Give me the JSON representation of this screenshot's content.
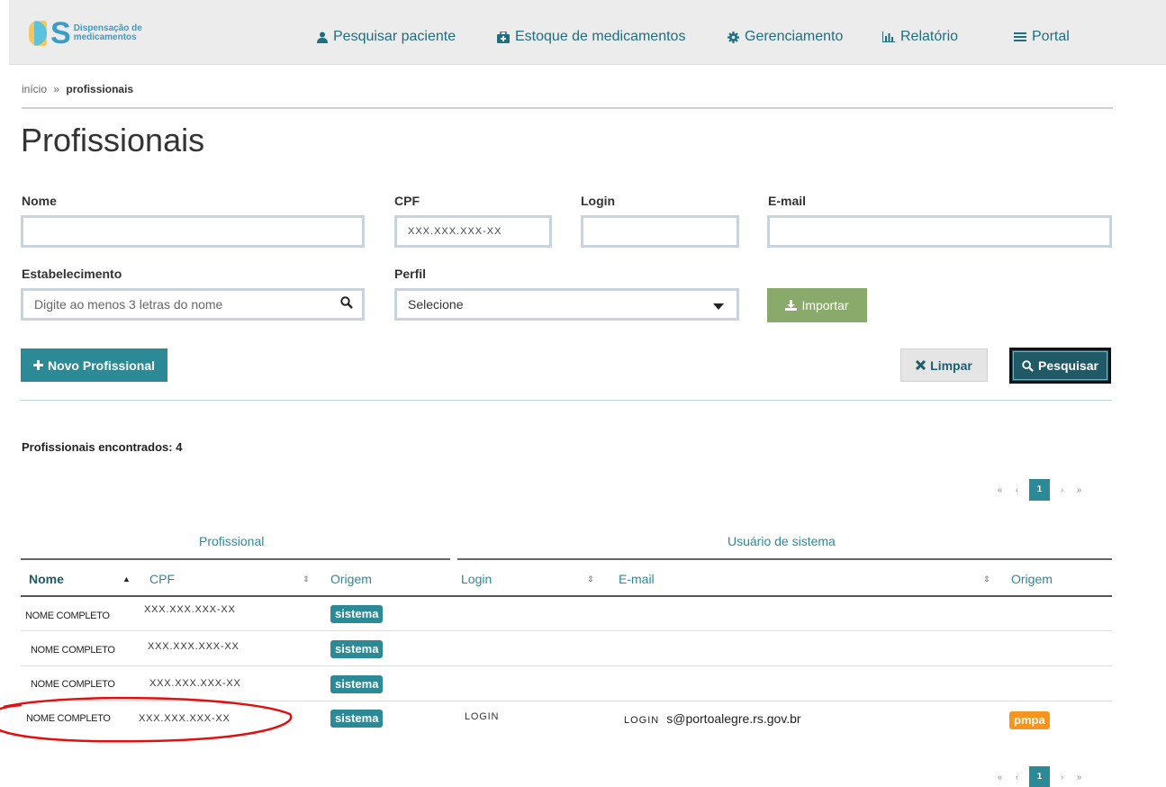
{
  "logo": {
    "line1": "Dispensação de",
    "line2": "medicamentos",
    "letters": "S"
  },
  "nav": [
    {
      "label": "Pesquisar paciente",
      "icon": "user-icon"
    },
    {
      "label": "Estoque de medicamentos",
      "icon": "medkit-icon"
    },
    {
      "label": "Gerenciamento",
      "icon": "gear-icon"
    },
    {
      "label": "Relatório",
      "icon": "bar-chart-icon"
    },
    {
      "label": "Portal",
      "icon": "menu-icon"
    }
  ],
  "breadcrumb": {
    "home": "início",
    "sep": "»",
    "current": "profissionais"
  },
  "page_title": "Profissionais",
  "form": {
    "nome_label": "Nome",
    "nome_value": "",
    "cpf_label": "CPF",
    "cpf_value": "XXX.XXX.XXX-XX",
    "login_label": "Login",
    "login_value": "",
    "email_label": "E-mail",
    "email_value": "",
    "estab_label": "Estabelecimento",
    "estab_placeholder": "Digite ao menos 3 letras do nome",
    "perfil_label": "Perfil",
    "perfil_value": "Selecione"
  },
  "buttons": {
    "importar": "Importar",
    "novo": "Novo Profissional",
    "limpar": "Limpar",
    "pesquisar": "Pesquisar"
  },
  "results": {
    "found_label": "Profissionais encontrados: 4"
  },
  "pagination": {
    "first": "«",
    "prev": "‹",
    "page": "1",
    "next": "›",
    "last": "»"
  },
  "table": {
    "group_profissional": "Profissional",
    "group_usuario": "Usuário de sistema",
    "headers": {
      "nome": "Nome",
      "cpf": "CPF",
      "origem": "Origem",
      "login": "Login",
      "email": "E-mail",
      "origem2": "Origem"
    },
    "rows": [
      {
        "nome": "NOME COMPLETO",
        "cpf": "XXX.XXX.XXX-XX",
        "origem": "sistema",
        "login": "",
        "email_login": "",
        "email_domain": "",
        "origem2": ""
      },
      {
        "nome": "NOME COMPLETO",
        "cpf": "XXX.XXX.XXX-XX",
        "origem": "sistema",
        "login": "",
        "email_login": "",
        "email_domain": "",
        "origem2": ""
      },
      {
        "nome": "NOME COMPLETO",
        "cpf": "XXX.XXX.XXX-XX",
        "origem": "sistema",
        "login": "",
        "email_login": "",
        "email_domain": "",
        "origem2": ""
      },
      {
        "nome": "NOME COMPLETO",
        "cpf": "XXX.XXX.XXX-XX",
        "origem": "sistema",
        "login": "LOGIN",
        "email_login": "LOGIN",
        "email_domain": "s@portoalegre.rs.gov.br",
        "origem2": "pmpa"
      }
    ]
  },
  "colors": {
    "teal": "#2c8a96",
    "dark_teal": "#1f5a66",
    "green": "#8aaa6b",
    "orange": "#f5941e",
    "annotation_red": "#e01010"
  }
}
